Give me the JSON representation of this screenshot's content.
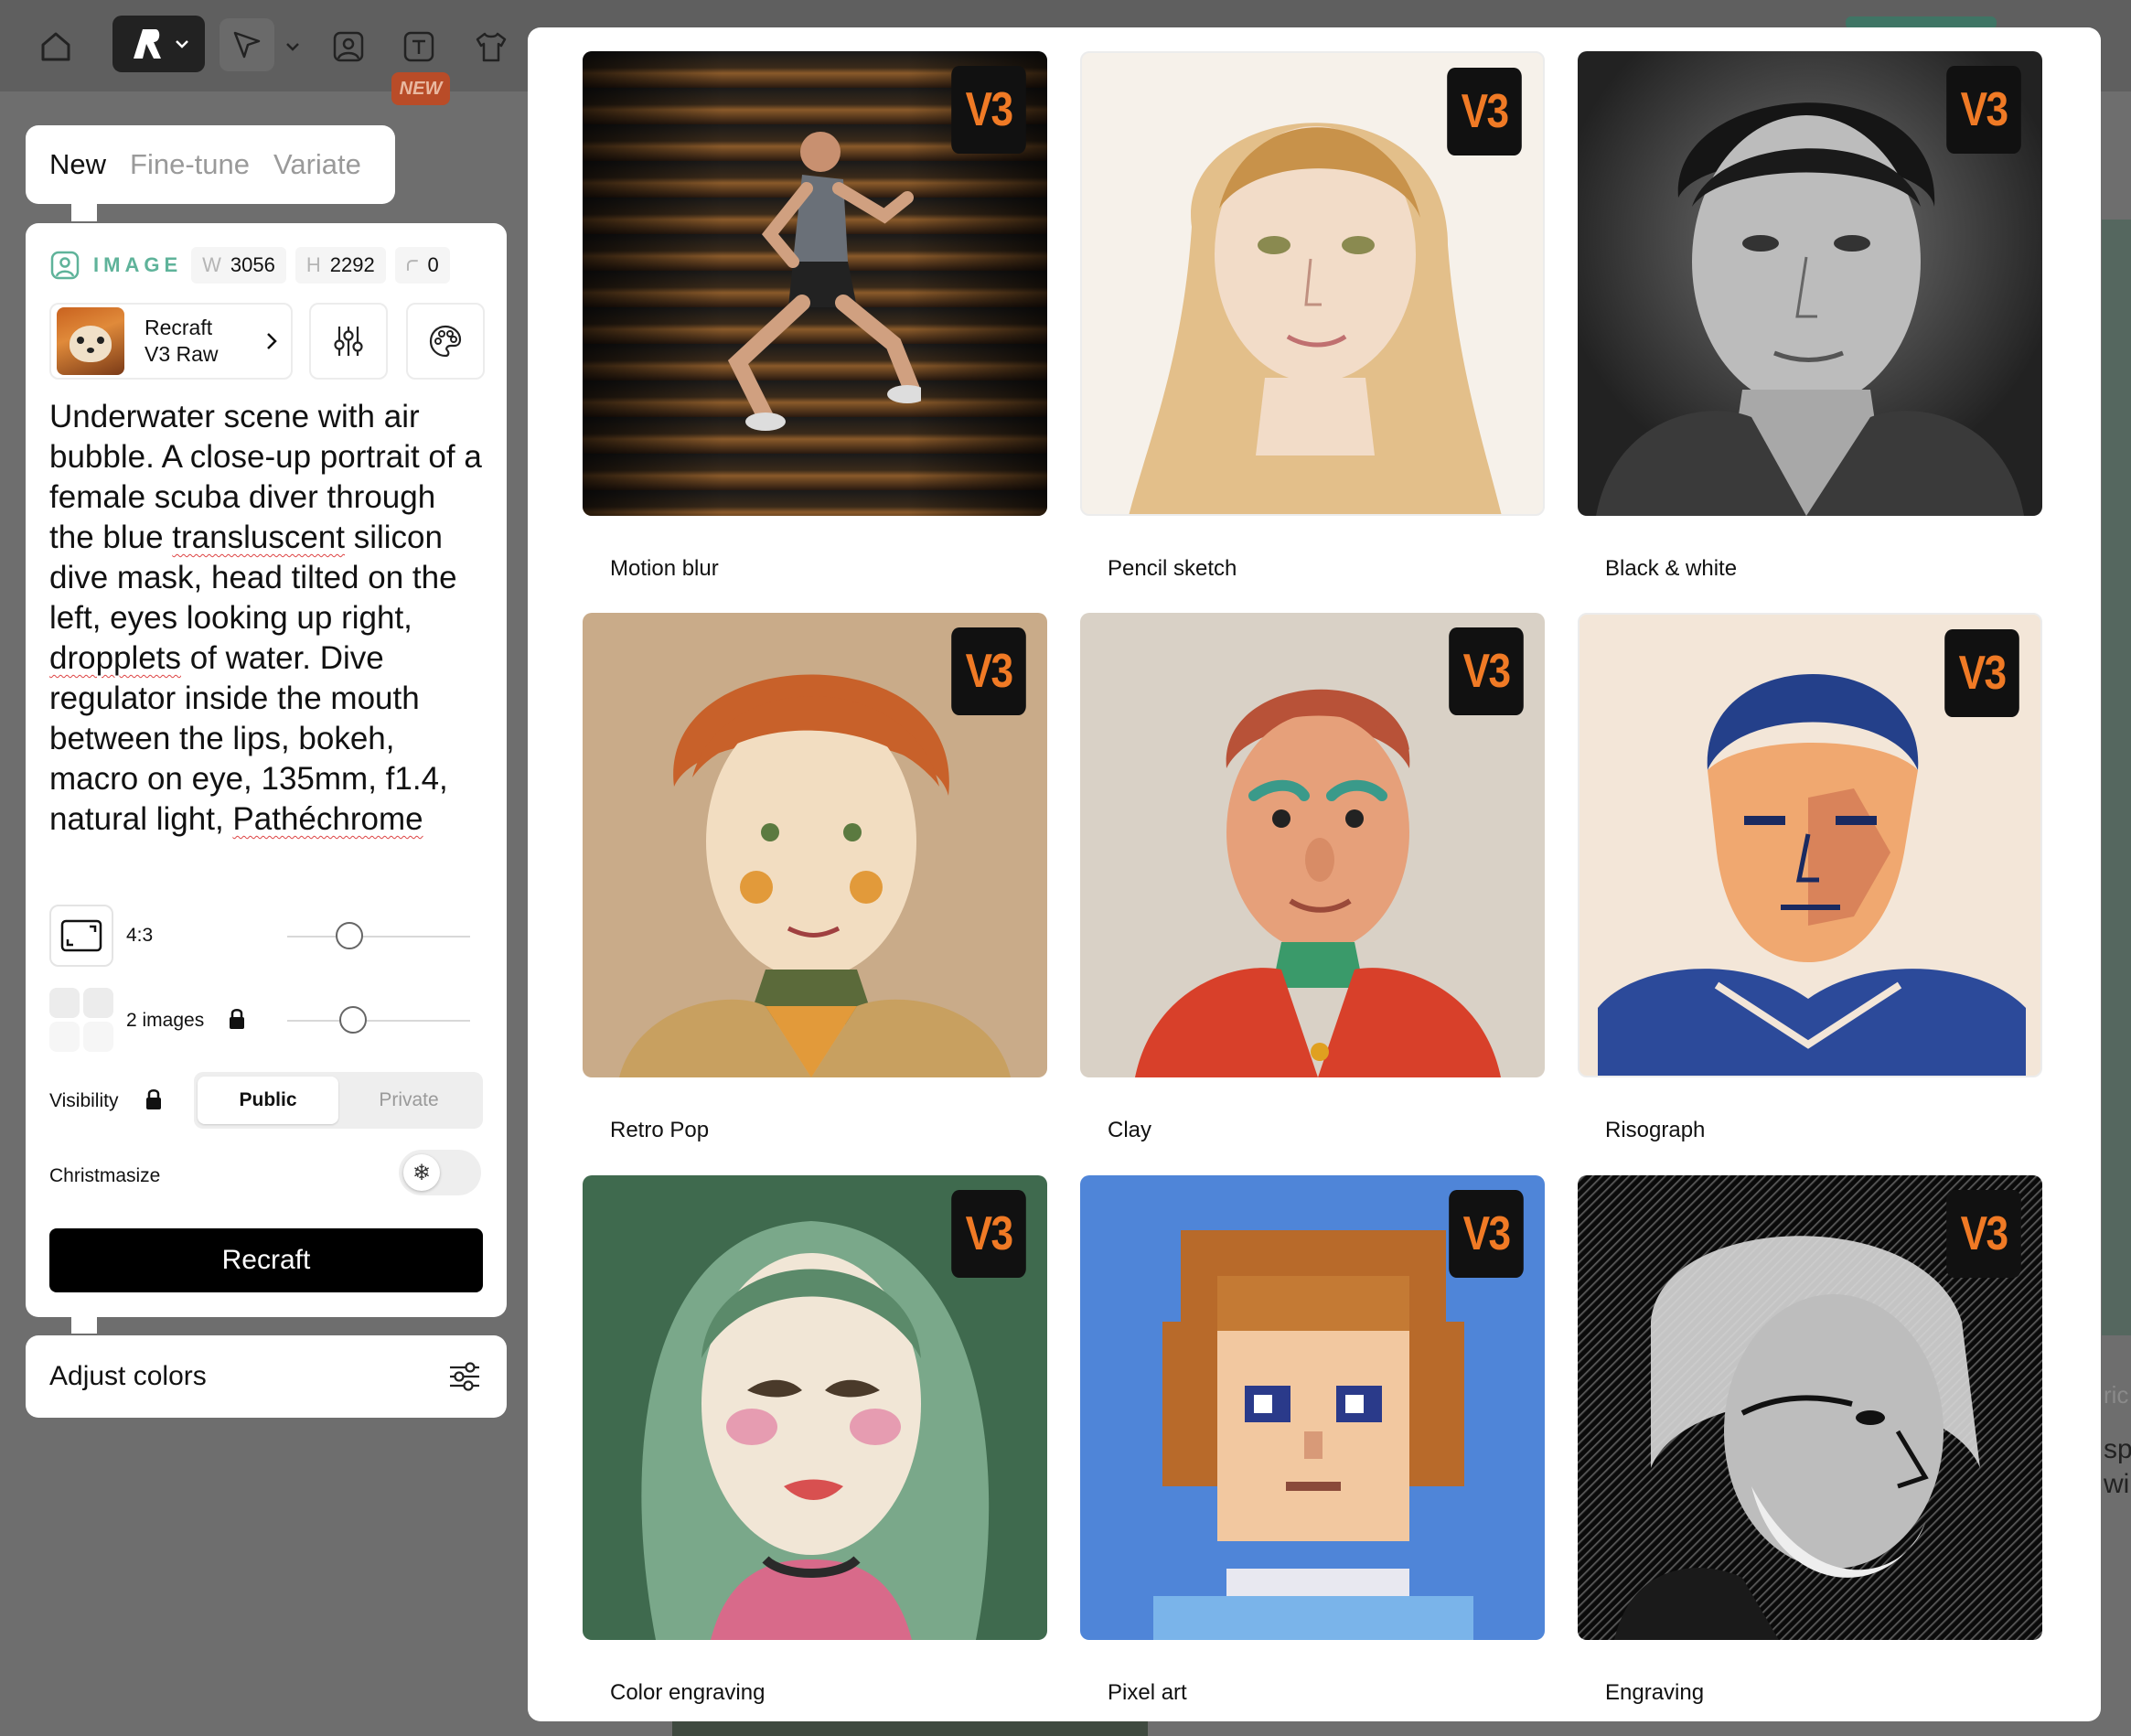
{
  "toolbar": {
    "icons": [
      "home-icon",
      "recraft-logo-icon",
      "select-arrow-icon",
      "image-icon",
      "text-image-icon",
      "tshirt-icon"
    ],
    "new_badge": "NEW"
  },
  "mode_tabs": [
    "New",
    "Fine-tune",
    "Variate"
  ],
  "image_settings": {
    "label": "IMAGE",
    "width_key": "W",
    "width": "3056",
    "height_key": "H",
    "height": "2292",
    "radius": "0"
  },
  "model": {
    "line1": "Recraft",
    "line2": "V3 Raw"
  },
  "prompt_parts": {
    "p1": "Underwater scene with air bubble. A close-up portrait of a female scuba diver through the blue ",
    "p2": "transluscent",
    "p3": " silicon dive mask, head tilted on the left, eyes looking up right, ",
    "p4": "dropplets",
    "p5": " of water. Dive regulator inside the mouth between the lips, bokeh, macro on eye, 135mm, f1.4, natural light, ",
    "p6": "Pathéchrome"
  },
  "aspect_ratio": {
    "label": "4:3",
    "slider_fraction": 0.34
  },
  "images_count": {
    "label": "2 images",
    "slider_fraction": 0.36
  },
  "visibility": {
    "label": "Visibility",
    "options": [
      "Public",
      "Private"
    ],
    "selected": "Public"
  },
  "christmasize": {
    "label": "Christmasize",
    "enabled": false
  },
  "recraft_button": "Recraft",
  "adjust_colors": "Adjust colors",
  "gallery": {
    "badge": "V3",
    "styles": [
      "Motion blur",
      "Pencil sketch",
      "Black & white",
      "Retro Pop",
      "Clay",
      "Risograph",
      "Color engraving",
      "Pixel art",
      "Engraving"
    ]
  },
  "background_fragments": [
    "ric",
    "sp",
    "wi"
  ],
  "colors": {
    "accent_teal": "#5fb39a",
    "badge_orange": "#f07a25",
    "new_badge_bg": "#b94c28"
  }
}
